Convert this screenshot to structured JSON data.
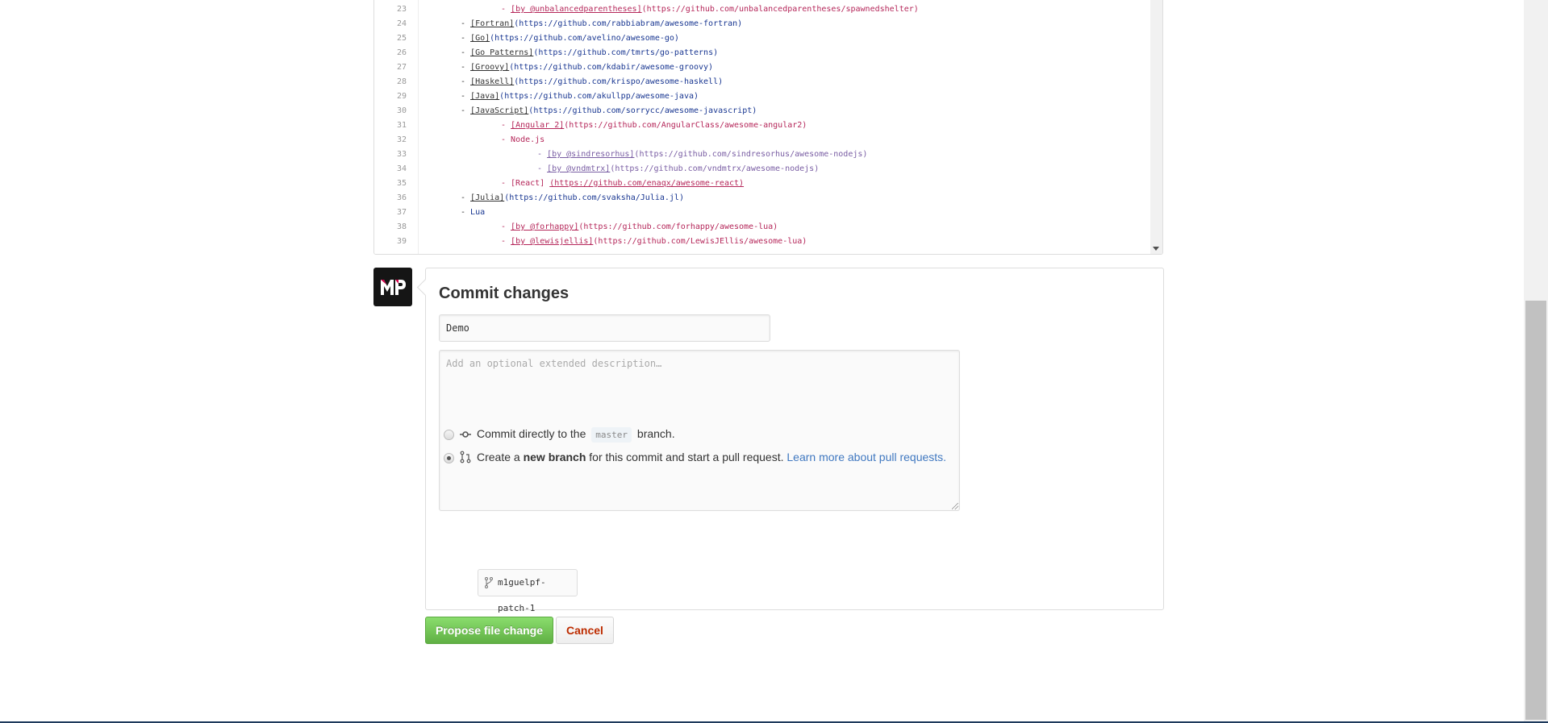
{
  "editor": {
    "lines": [
      {
        "n": "23",
        "level": 2,
        "dash": "- ",
        "link": "[by @unbalancedparentheses]",
        "url": "(https://github.com/unbalancedparentheses/spawnedshelter)"
      },
      {
        "n": "24",
        "level": 1,
        "dash": "- ",
        "link": "[Fortran]",
        "url": "(https://github.com/rabbiabram/awesome-fortran)"
      },
      {
        "n": "25",
        "level": 1,
        "dash": "- ",
        "link": "[Go]",
        "url": "(https://github.com/avelino/awesome-go)"
      },
      {
        "n": "26",
        "level": 1,
        "dash": "- ",
        "link": "[Go Patterns]",
        "url": "(https://github.com/tmrts/go-patterns)"
      },
      {
        "n": "27",
        "level": 1,
        "dash": "- ",
        "link": "[Groovy]",
        "url": "(https://github.com/kdabir/awesome-groovy)"
      },
      {
        "n": "28",
        "level": 1,
        "dash": "- ",
        "link": "[Haskell]",
        "url": "(https://github.com/krispo/awesome-haskell)"
      },
      {
        "n": "29",
        "level": 1,
        "dash": "- ",
        "link": "[Java]",
        "url": "(https://github.com/akullpp/awesome-java)"
      },
      {
        "n": "30",
        "level": 1,
        "dash": "- ",
        "link": "[JavaScript]",
        "url": "(https://github.com/sorrycc/awesome-javascript)"
      },
      {
        "n": "31",
        "level": 2,
        "dash": "- ",
        "link": "[Angular 2]",
        "url": "(https://github.com/AngularClass/awesome-angular2)"
      },
      {
        "n": "32",
        "level": 2,
        "dash": "- ",
        "link": "",
        "url": "Node.js"
      },
      {
        "n": "33",
        "level": 3,
        "dash": "- ",
        "link": "[by @sindresorhus]",
        "url": "(https://github.com/sindresorhus/awesome-nodejs)"
      },
      {
        "n": "34",
        "level": 3,
        "dash": "- ",
        "link": "[by @vndmtrx]",
        "url": "(https://github.com/vndmtrx/awesome-nodejs)"
      },
      {
        "n": "35",
        "level": 2,
        "dash": "- [React] ",
        "link": "(https://github.com/enaqx/awesome-react)",
        "url": ""
      },
      {
        "n": "36",
        "level": 1,
        "dash": "- ",
        "link": "[Julia]",
        "url": "(https://github.com/svaksha/Julia.jl)"
      },
      {
        "n": "37",
        "level": 1,
        "dash": "- ",
        "link": "",
        "url": "Lua"
      },
      {
        "n": "38",
        "level": 2,
        "dash": "- ",
        "link": "[by @forhappy]",
        "url": "(https://github.com/forhappy/awesome-lua)"
      },
      {
        "n": "39",
        "level": 2,
        "dash": "- ",
        "link": "[by @lewisjellis]",
        "url": "(https://github.com/LewisJEllis/awesome-lua)"
      }
    ]
  },
  "avatar": {
    "initials": "MP",
    "accent": "#d6004b"
  },
  "commit": {
    "title": "Commit changes",
    "message_value": "Demo",
    "description_placeholder": "Add an optional extended description…",
    "option_direct": {
      "before": "Commit directly to the",
      "branch": "master",
      "after": "branch.",
      "selected": false
    },
    "option_new": {
      "before": "Create a ",
      "bold": "new branch",
      "after": " for this commit and start a pull request. ",
      "link": "Learn more about pull requests.",
      "selected": true
    },
    "branch_name": "m1guelpf-patch-1",
    "propose_label": "Propose file change",
    "cancel_label": "Cancel"
  },
  "colors": {
    "propose_green": "#60b044",
    "cancel_red": "#bd2c00",
    "link_blue": "#4078c0"
  }
}
